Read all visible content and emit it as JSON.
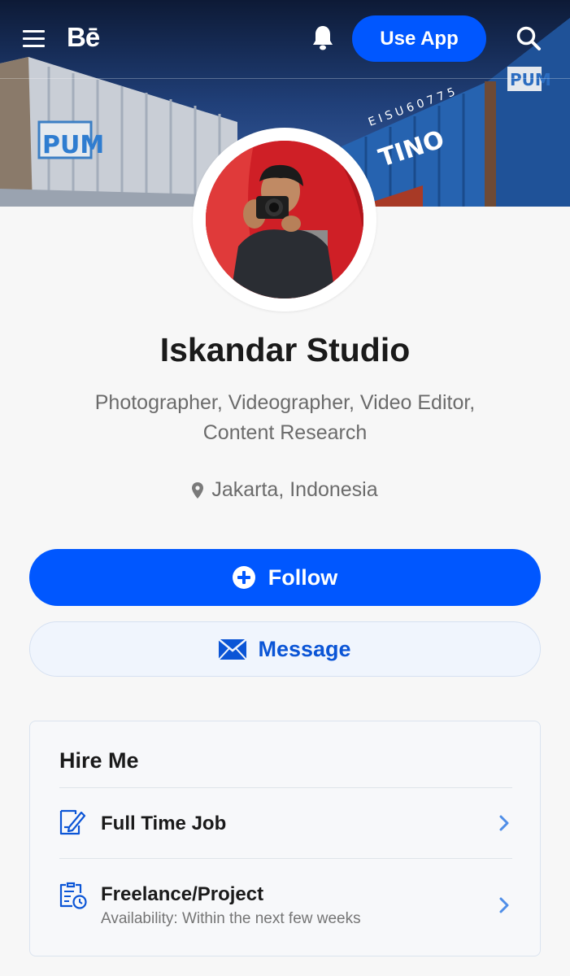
{
  "header": {
    "logo": "Bē",
    "use_app_label": "Use App"
  },
  "profile": {
    "name": "Iskandar Studio",
    "headline_line1": "Photographer, Videographer, Video Editor,",
    "headline_line2": "Content Research",
    "location": "Jakarta, Indonesia"
  },
  "actions": {
    "follow_label": "Follow",
    "message_label": "Message"
  },
  "hire": {
    "title": "Hire Me",
    "options": [
      {
        "label": "Full Time Job",
        "icon": "pen-document-icon"
      },
      {
        "label": "Freelance/Project",
        "sublabel": "Availability: Within the next few weeks",
        "icon": "clipboard-clock-icon"
      }
    ]
  },
  "colors": {
    "accent": "#0057ff",
    "message_text": "#0b55d6",
    "page_bg": "#f7f7f7"
  }
}
